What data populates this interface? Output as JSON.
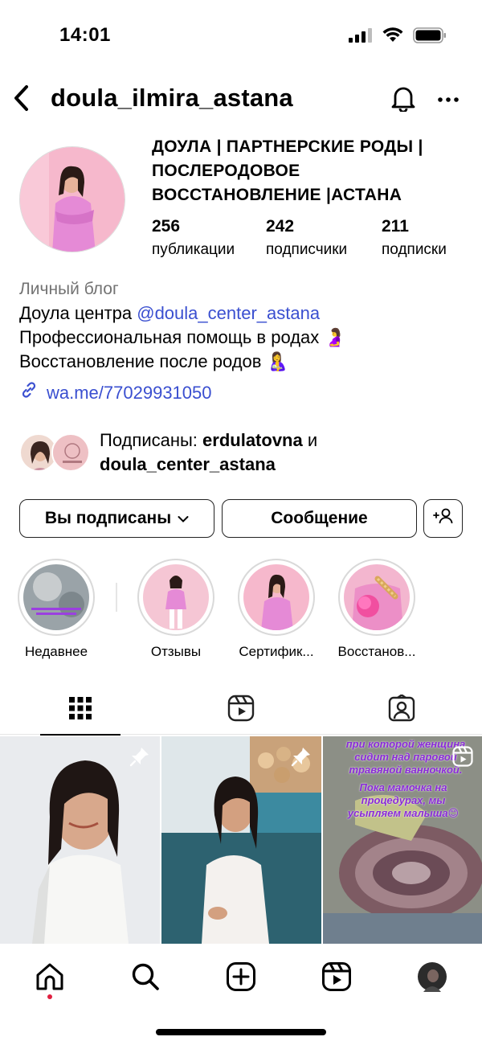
{
  "status_bar": {
    "time": "14:01",
    "battery_icon": "battery-icon",
    "wifi_icon": "wifi-icon",
    "signal_icon": "signal-icon"
  },
  "header": {
    "username": "doula_ilmira_astana",
    "back_icon": "chevron-left-icon",
    "bell_icon": "bell-icon",
    "more_icon": "more-horizontal-icon"
  },
  "profile": {
    "display_name": "ДОУЛА | ПАРТНЕРСКИЕ РОДЫ | ПОСЛЕРОДОВОЕ ВОССТАНОВЛЕНИЕ |АСТАНА",
    "stats": [
      {
        "value": "256",
        "label": "публикации"
      },
      {
        "value": "242",
        "label": "подписчики"
      },
      {
        "value": "211",
        "label": "подписки"
      }
    ]
  },
  "bio": {
    "category": "Личный блог",
    "line1_prefix": "Доула центра ",
    "line1_mention": "@doula_center_astana",
    "line2": "Профессиональная помощь в родах 🤰",
    "line3": "Восстановление после родов 🤱",
    "link": "wa.me/77029931050"
  },
  "followed_by": {
    "prefix": "Подписаны: ",
    "user1": "erdulatovna",
    "joiner": " и",
    "user2": "doula_center_astana"
  },
  "actions": {
    "following_label": "Вы подписаны",
    "message_label": "Сообщение"
  },
  "highlights": [
    {
      "label": "Недавнее"
    },
    {
      "label": "Отзывы"
    },
    {
      "label": "Сертифик..."
    },
    {
      "label": "Восстанов..."
    }
  ],
  "posts": [
    {
      "pinned": true
    },
    {
      "pinned": true
    },
    {
      "caption_top": "при которой женщина сидит над паровой травяной ванночкой.",
      "caption_bottom": "Пока мамочка на процедурах, мы усыпляем малыша😊"
    }
  ],
  "colors": {
    "link": "#3a4fd0",
    "caption": "#8a2bd8",
    "notification_dot": "#e02040"
  }
}
